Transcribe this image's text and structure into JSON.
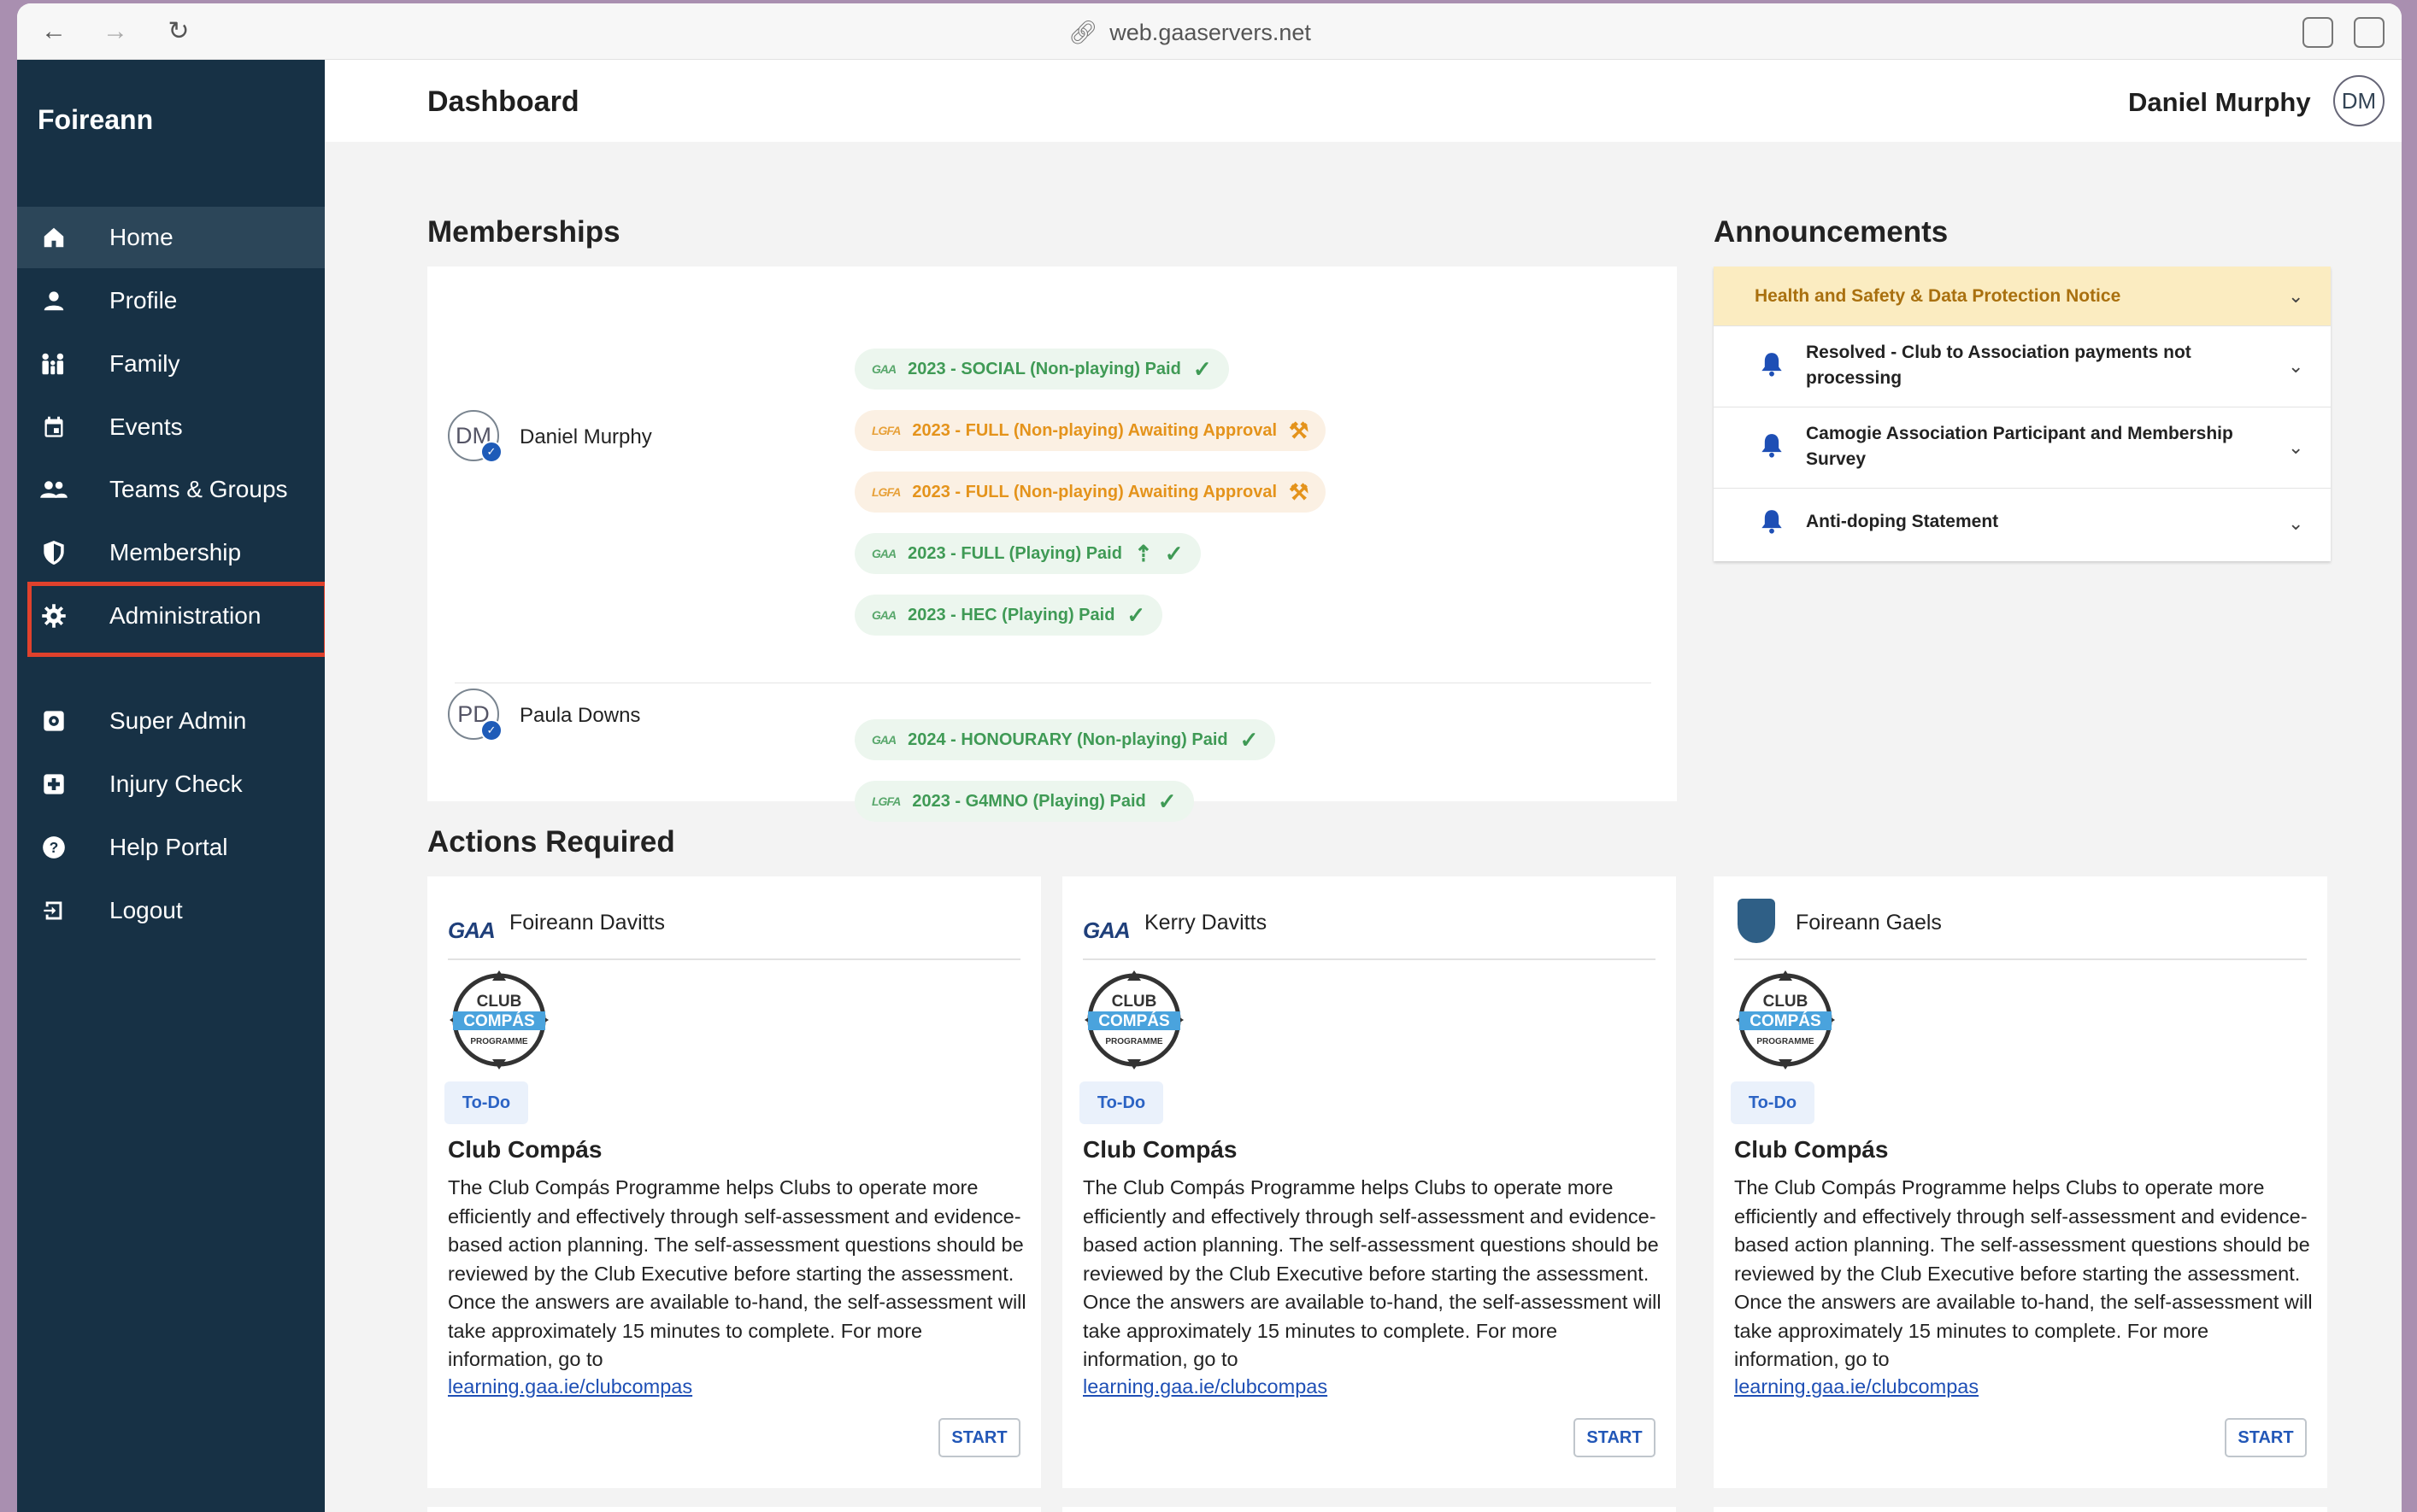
{
  "browser": {
    "url": "web.gaaservers.net"
  },
  "sidebar": {
    "brand": "Foireann",
    "items": [
      {
        "label": "Home",
        "icon": "home-icon"
      },
      {
        "label": "Profile",
        "icon": "person-icon"
      },
      {
        "label": "Family",
        "icon": "family-icon"
      },
      {
        "label": "Events",
        "icon": "calendar-icon"
      },
      {
        "label": "Teams & Groups",
        "icon": "group-icon"
      },
      {
        "label": "Membership",
        "icon": "shield-icon"
      },
      {
        "label": "Administration",
        "icon": "gear-icon"
      },
      {
        "label": "Super Admin",
        "icon": "admin-gear-icon"
      },
      {
        "label": "Injury Check",
        "icon": "medical-plus-icon"
      },
      {
        "label": "Help Portal",
        "icon": "help-icon"
      },
      {
        "label": "Logout",
        "icon": "logout-icon"
      }
    ],
    "active_index": 0
  },
  "header": {
    "title": "Dashboard",
    "user_name": "Daniel Murphy",
    "user_initials": "DM"
  },
  "memberships": {
    "heading": "Memberships",
    "people": [
      {
        "initials": "DM",
        "name": "Daniel Murphy",
        "pills": [
          {
            "logo": "GAA",
            "text": "2023 - SOCIAL (Non-playing) Paid",
            "status": "paid"
          },
          {
            "logo": "LGFA",
            "text": "2023 - FULL (Non-playing) Awaiting Approval",
            "status": "awaiting"
          },
          {
            "logo": "LGFA",
            "text": "2023 - FULL (Non-playing) Awaiting Approval",
            "status": "awaiting"
          },
          {
            "logo": "GAA",
            "text": "2023 - FULL (Playing) Paid",
            "status": "paid-upgrade"
          },
          {
            "logo": "GAA",
            "text": "2023 - HEC (Playing) Paid",
            "status": "paid"
          }
        ]
      },
      {
        "initials": "PD",
        "name": "Paula Downs",
        "pills": [
          {
            "logo": "GAA",
            "text": "2024 - HONOURARY (Non-playing) Paid",
            "status": "paid"
          },
          {
            "logo": "LGFA",
            "text": "2023 - G4MNO (Playing) Paid",
            "status": "paid"
          }
        ]
      }
    ]
  },
  "announcements": {
    "heading": "Announcements",
    "items": [
      {
        "text": "Health and Safety & Data Protection Notice"
      },
      {
        "text": "Resolved - Club to Association payments not processing"
      },
      {
        "text": "Camogie Association Participant and Membership Survey"
      },
      {
        "text": "Anti-doping Statement"
      }
    ]
  },
  "actions": {
    "heading": "Actions Required",
    "cards": [
      {
        "club": "Foireann Davitts",
        "logo": "GAA",
        "badge_top": "CLUB",
        "badge_mid": "COMPÁS",
        "badge_bottom": "PROGRAMME",
        "status": "To-Do",
        "title": "Club Compás",
        "description": "The Club Compás Programme helps Clubs to operate more efficiently and effectively through self-assessment and evidence-based action planning. The self-assessment questions should be reviewed by the Club Executive before starting the assessment. Once the answers are available to-hand, the self-assessment will take approximately 15 minutes to complete. For more information, go to",
        "link": "learning.gaa.ie/clubcompas",
        "button": "START"
      },
      {
        "club": "Kerry Davitts",
        "logo": "GAA",
        "badge_top": "CLUB",
        "badge_mid": "COMPÁS",
        "badge_bottom": "PROGRAMME",
        "status": "To-Do",
        "title": "Club Compás",
        "description": "The Club Compás Programme helps Clubs to operate more efficiently and effectively through self-assessment and evidence-based action planning. The self-assessment questions should be reviewed by the Club Executive before starting the assessment. Once the answers are available to-hand, the self-assessment will take approximately 15 minutes to complete. For more information, go to",
        "link": "learning.gaa.ie/clubcompas",
        "button": "START"
      },
      {
        "club": "Foireann Gaels",
        "logo": "crest",
        "badge_top": "CLUB",
        "badge_mid": "COMPÁS",
        "badge_bottom": "PROGRAMME",
        "status": "To-Do",
        "title": "Club Compás",
        "description": "The Club Compás Programme helps Clubs to operate more efficiently and effectively through self-assessment and evidence-based action planning. The self-assessment questions should be reviewed by the Club Executive before starting the assessment. Once the answers are available to-hand, the self-assessment will take approximately 15 minutes to complete. For more information, go to",
        "link": "learning.gaa.ie/clubcompas",
        "button": "START"
      }
    ]
  },
  "colors": {
    "sidebar_bg": "#173145",
    "active_item_bg": "#2c4659",
    "highlight_border": "#e0412c",
    "paid_green": "#3f9a55",
    "awaiting_orange": "#e4931b",
    "link_blue": "#1e4fb5",
    "announce_highlight": "#fbecc1"
  }
}
